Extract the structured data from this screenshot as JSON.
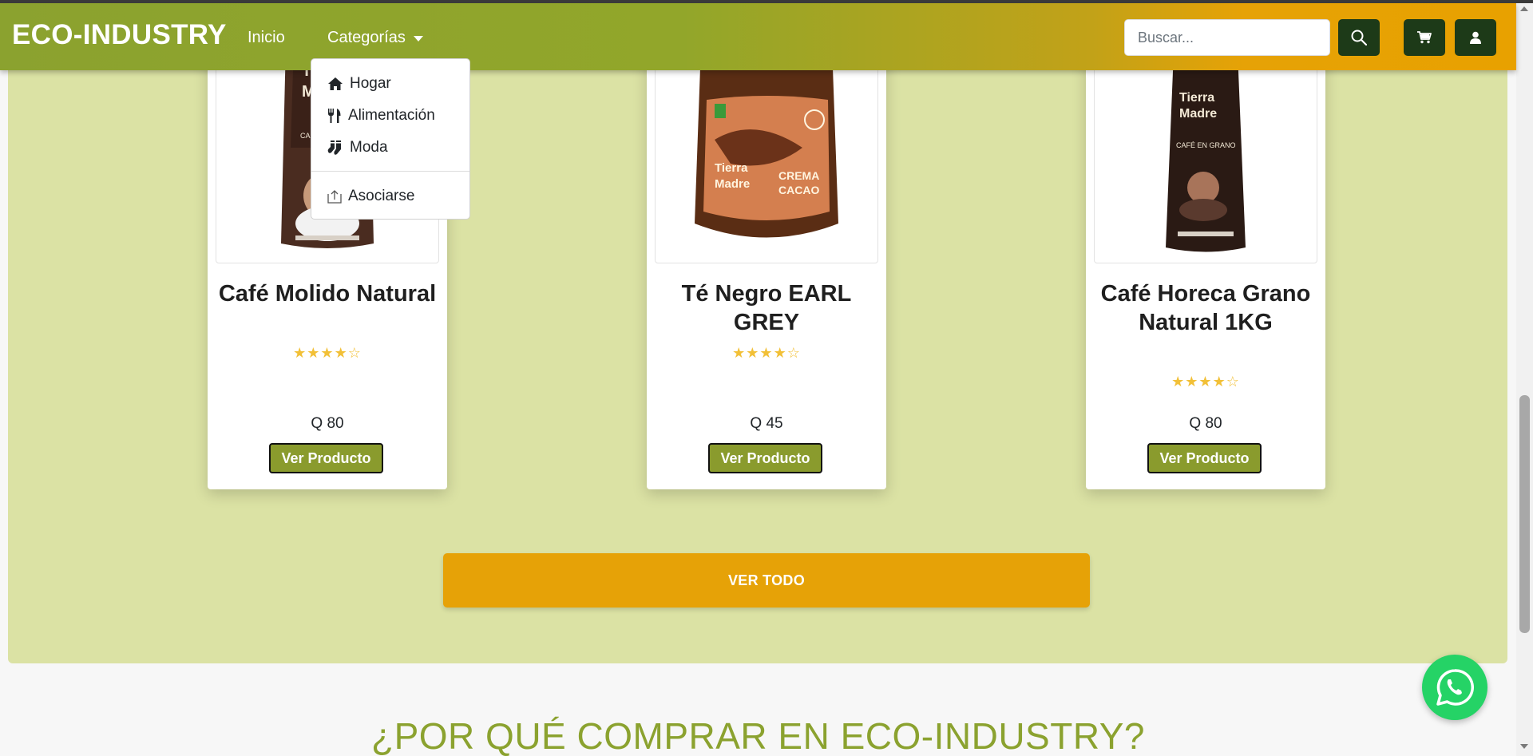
{
  "navbar": {
    "brand": "ECO-INDUSTRY",
    "links": {
      "home": "Inicio",
      "categories": "Categorías"
    },
    "search_placeholder": "Buscar...",
    "gradient": [
      "#8ba22f",
      "#e8a100"
    ]
  },
  "dropdown": {
    "items": [
      {
        "label": "Hogar",
        "icon": "home-icon"
      },
      {
        "label": "Alimentación",
        "icon": "utensils-icon"
      },
      {
        "label": "Moda",
        "icon": "socks-icon"
      }
    ],
    "footer_item": {
      "label": "Asociarse",
      "icon": "share-icon"
    }
  },
  "products": [
    {
      "name": "Café Molido Natural",
      "price": "Q 80",
      "rating": 4,
      "rating_max": 5,
      "button": "Ver Producto"
    },
    {
      "name": "Té Negro EARL GREY",
      "price": "Q 45",
      "rating": 4,
      "rating_max": 5,
      "button": "Ver Producto"
    },
    {
      "name": "Café Horeca Grano Natural 1KG",
      "price": "Q 80",
      "rating": 4,
      "rating_max": 5,
      "button": "Ver Producto"
    }
  ],
  "view_all": "VER TODO",
  "why_title": "¿POR QUÉ COMPRAR EN ECO-INDUSTRY?",
  "colors": {
    "section_bg": "#dbe2a4",
    "accent_orange": "#e6a207",
    "dark_green": "#1d3a18",
    "button_green": "#8a9b2d",
    "whatsapp": "#25d366",
    "star": "#f2c037"
  }
}
